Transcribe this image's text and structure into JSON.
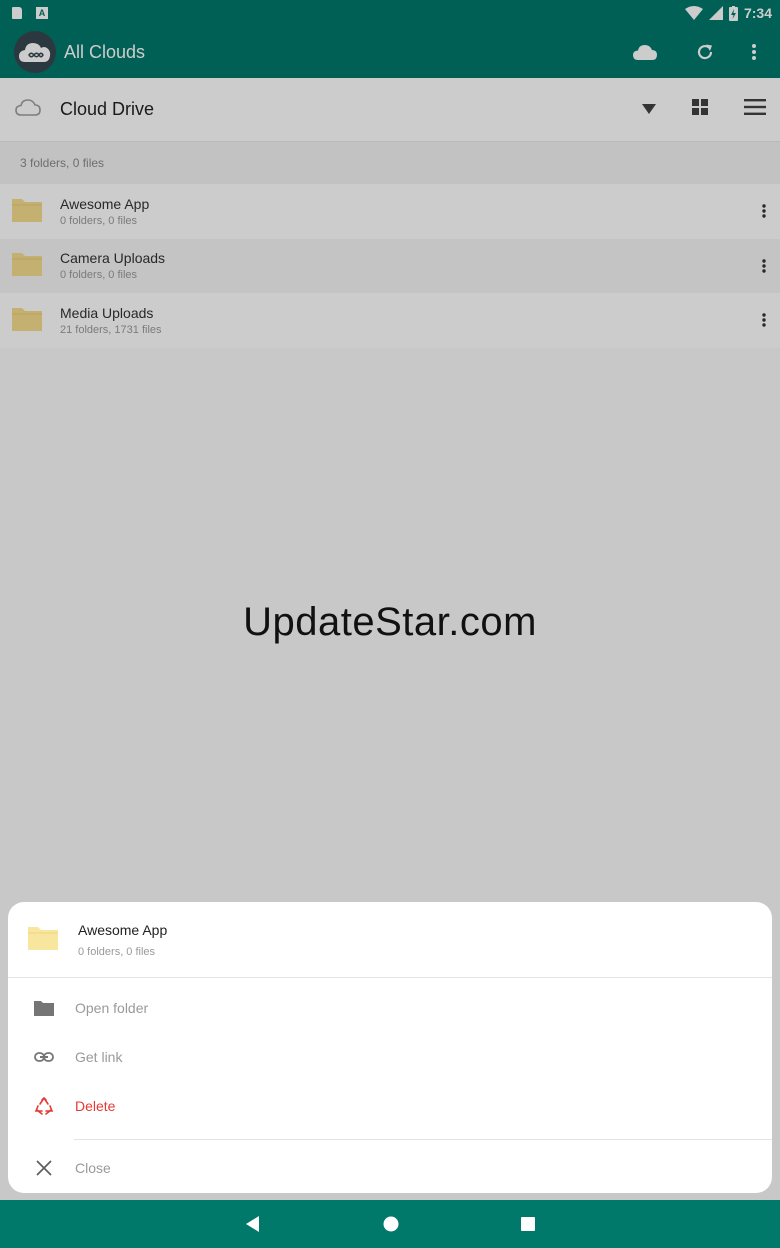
{
  "status_bar": {
    "time": "7:34",
    "icons": [
      "sd-card-icon",
      "a-notification-icon",
      "wifi-icon",
      "signal-icon",
      "battery-charging-icon"
    ]
  },
  "app_bar": {
    "title": "All Clouds",
    "actions": [
      "cloud-icon",
      "refresh-icon",
      "more-vert-icon"
    ]
  },
  "sub_bar": {
    "title": "Cloud Drive",
    "tools": [
      "dropdown-arrow-icon",
      "grid-view-icon",
      "list-menu-icon"
    ]
  },
  "summary": "3 folders, 0 files",
  "folders": [
    {
      "name": "Awesome App",
      "meta": "0 folders, 0 files"
    },
    {
      "name": "Camera Uploads",
      "meta": "0 folders, 0 files"
    },
    {
      "name": "Media Uploads",
      "meta": "21 folders, 1731 files"
    }
  ],
  "watermark": "UpdateStar.com",
  "sheet": {
    "folder_name": "Awesome App",
    "folder_meta": "0 folders, 0 files",
    "open_folder": "Open folder",
    "get_link": "Get link",
    "delete": "Delete",
    "close": "Close"
  },
  "colors": {
    "primary": "#00796b",
    "folder": "#f5de8f",
    "delete": "#e53935"
  }
}
